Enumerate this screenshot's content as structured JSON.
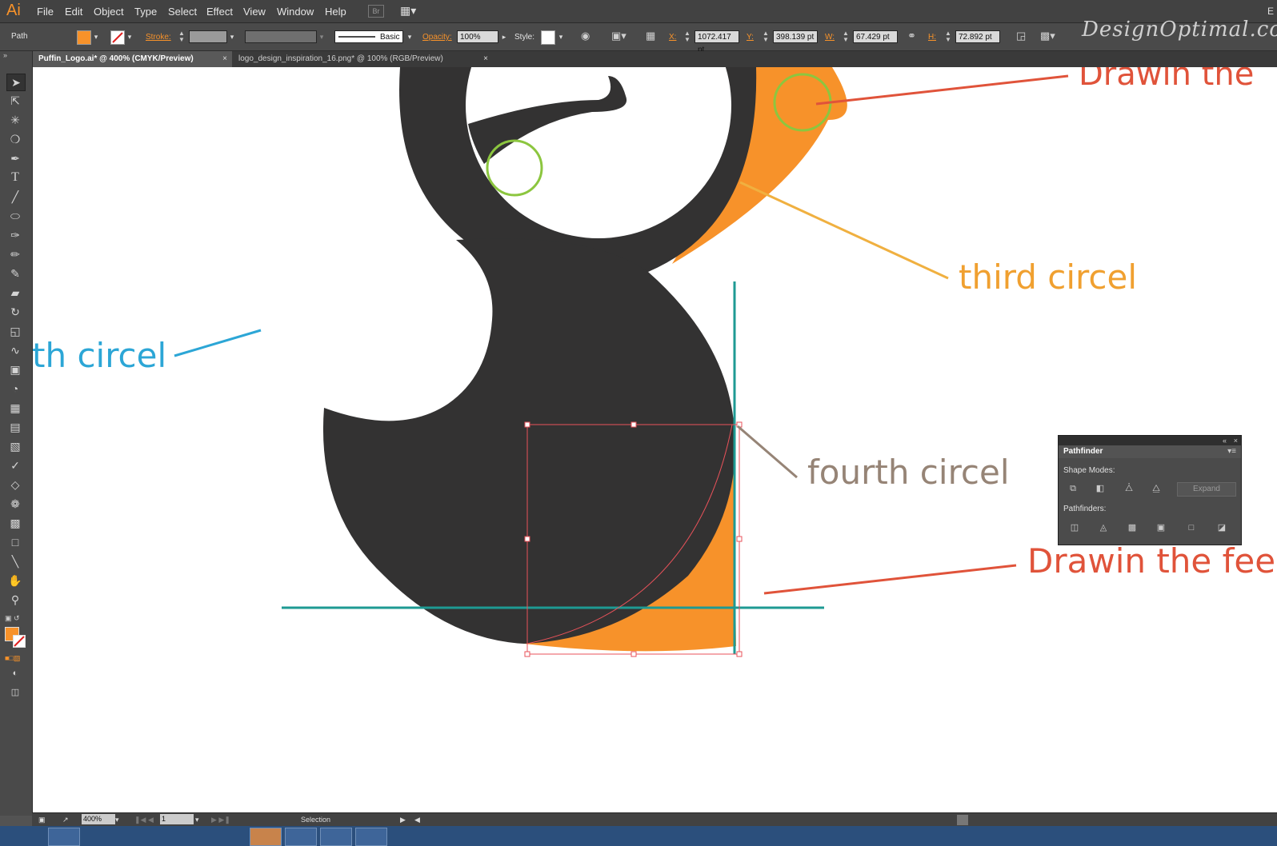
{
  "app": {
    "logo": "Ai",
    "menus": [
      "File",
      "Edit",
      "Object",
      "Type",
      "Select",
      "Effect",
      "View",
      "Window",
      "Help"
    ],
    "bridge_label": "Br",
    "right_edge": "E",
    "watermark": "DesignOptimal.com"
  },
  "control_bar": {
    "selection_type": "Path",
    "fill_color": "#f7922a",
    "stroke_label": "Stroke:",
    "brush_label": "Basic",
    "opacity_label": "Opacity:",
    "opacity_value": "100%",
    "style_label": "Style:",
    "x_label": "X:",
    "x_value": "1072.417 pt",
    "y_label": "Y:",
    "y_value": "398.139 pt",
    "w_label": "W:",
    "w_value": "67.429 pt",
    "h_label": "H:",
    "h_value": "72.892 pt"
  },
  "tabs": [
    {
      "label": "Puffin_Logo.ai* @ 400% (CMYK/Preview)",
      "active": true
    },
    {
      "label": "logo_design_inspiration_16.png* @ 100% (RGB/Preview)",
      "active": false
    }
  ],
  "tools": [
    "selection-tool",
    "direct-selection-tool",
    "magic-wand-tool",
    "lasso-tool",
    "pen-tool",
    "type-tool",
    "line-segment-tool",
    "ellipse-tool",
    "paintbrush-tool",
    "pencil-tool",
    "blob-brush-tool",
    "eraser-tool",
    "rotate-tool",
    "scale-tool",
    "warp-tool",
    "free-transform-tool",
    "shape-builder-tool",
    "perspective-grid-tool",
    "mesh-tool",
    "gradient-tool",
    "eyedropper-tool",
    "blend-tool",
    "symbol-sprayer-tool",
    "column-graph-tool",
    "artboard-tool",
    "slice-tool",
    "hand-tool",
    "zoom-tool"
  ],
  "artwork": {
    "body_color": "#333232",
    "beak_color": "#f7922a",
    "guide_color": "#1e9a93",
    "circle_color": "#8cc63f",
    "selection_color": "#e8525a"
  },
  "annotations": {
    "drawin_top": {
      "text": "Drawin the",
      "color": "#e0533a"
    },
    "third_circel": {
      "text": "third  circel",
      "color": "#f0a030"
    },
    "th_circel": {
      "text": "th circel",
      "color": "#2ca6d6"
    },
    "fourth_circel": {
      "text": "fourth circel",
      "color": "#968476"
    },
    "drawin_feet": {
      "text": "Drawin the fee",
      "color": "#e0533a"
    }
  },
  "pathfinder": {
    "title": "Pathfinder",
    "shape_modes_label": "Shape Modes:",
    "pathfinders_label": "Pathfinders:",
    "expand_label": "Expand"
  },
  "status": {
    "zoom": "400%",
    "artboard": "1",
    "tool": "Selection"
  }
}
